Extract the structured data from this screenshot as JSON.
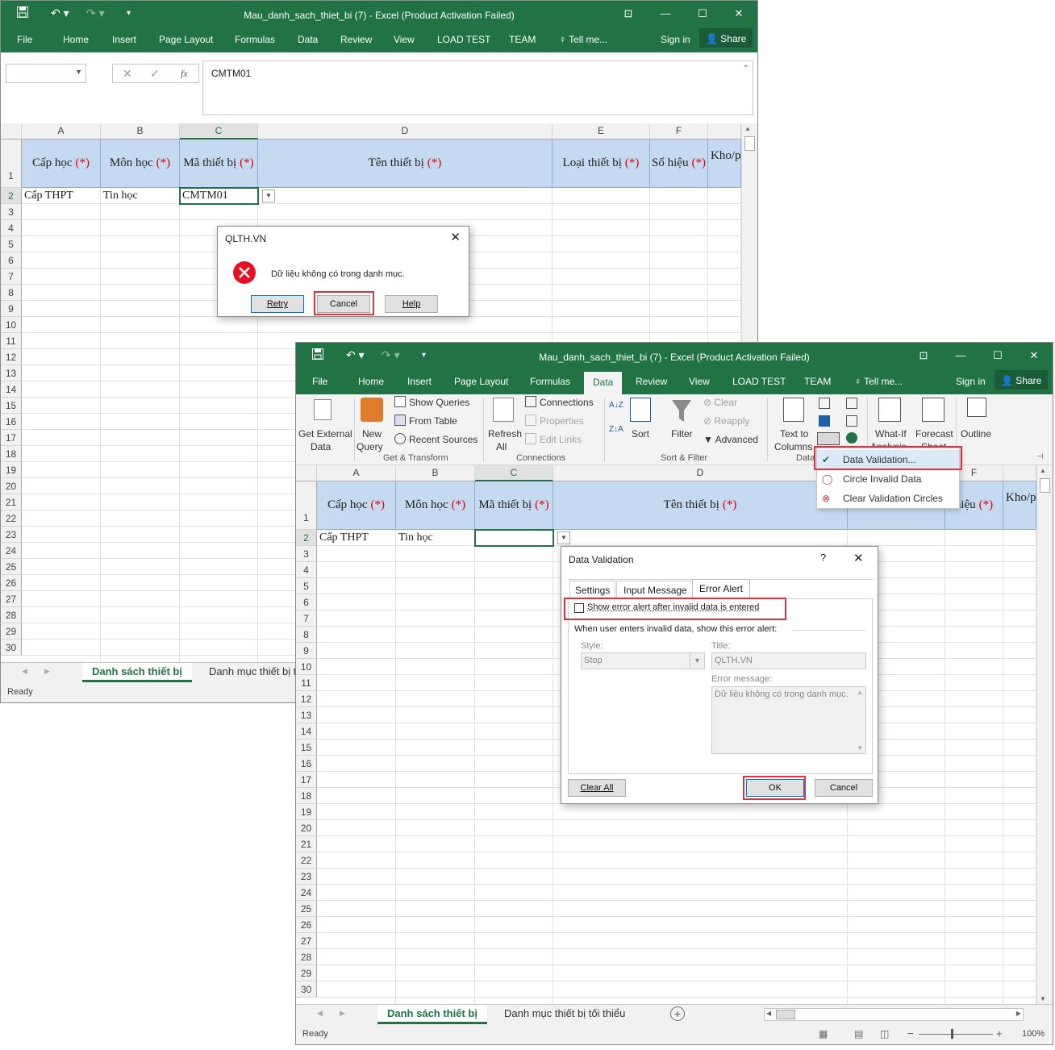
{
  "back": {
    "title": "Mau_danh_sach_thiet_bi (7) - Excel (Product Activation Failed)",
    "menu": [
      "File",
      "Home",
      "Insert",
      "Page Layout",
      "Formulas",
      "Data",
      "Review",
      "View",
      "LOAD TEST",
      "TEAM"
    ],
    "tellme": "Tell me...",
    "signin": "Sign in",
    "share": "Share",
    "formula": "CMTM01",
    "fx": "fx",
    "columns": [
      "A",
      "B",
      "C",
      "D",
      "E",
      "F"
    ],
    "rows": [
      "1",
      "2",
      "3",
      "4",
      "5",
      "6",
      "7",
      "8",
      "9",
      "10",
      "11",
      "12",
      "13",
      "14",
      "15",
      "16",
      "17",
      "18",
      "19",
      "20",
      "21",
      "22",
      "23",
      "24",
      "25",
      "26",
      "27",
      "28",
      "29",
      "30"
    ],
    "headers": [
      "Cấp học",
      "Môn học",
      "Mã thiết bị",
      "Tên thiết bị",
      "Loại thiết bị",
      "Số hiệu",
      "Kho/p"
    ],
    "req": "(*)",
    "row2": [
      "Cấp THPT",
      "Tin học",
      "CMTM01"
    ],
    "tabs": [
      "Danh sách thiết bị",
      "Danh mục thiết bị t"
    ],
    "status": "Ready"
  },
  "alert": {
    "title": "QLTH.VN",
    "message": "Dữ liệu không có trong danh mục.",
    "retry": "Retry",
    "cancel": "Cancel",
    "help": "Help"
  },
  "front": {
    "title": "Mau_danh_sach_thiet_bi (7) - Excel (Product Activation Failed)",
    "menu": [
      "File",
      "Home",
      "Insert",
      "Page Layout",
      "Formulas",
      "Data",
      "Review",
      "View",
      "LOAD TEST",
      "TEAM"
    ],
    "tellme": "Tell me...",
    "signin": "Sign in",
    "share": "Share",
    "ribbon": {
      "get_external": [
        "Get External",
        "Data"
      ],
      "new_query": [
        "New",
        "Query"
      ],
      "show_queries": "Show Queries",
      "from_table": "From Table",
      "recent_sources": "Recent Sources",
      "refresh_all": [
        "Refresh",
        "All"
      ],
      "connections": "Connections",
      "properties": "Properties",
      "edit_links": "Edit Links",
      "sort": "Sort",
      "filter": "Filter",
      "clear": "Clear",
      "reapply": "Reapply",
      "advanced": "Advanced",
      "text_to_columns": [
        "Text to",
        "Columns"
      ],
      "what_if": [
        "What-If",
        "Analysis"
      ],
      "forecast": [
        "Forecast",
        "Sheet"
      ],
      "outline": "Outline",
      "groups": [
        "Get & Transform",
        "Connections",
        "Sort & Filter",
        "Data"
      ]
    },
    "dv_menu": [
      "Data Validation...",
      "Circle Invalid Data",
      "Clear Validation Circles"
    ],
    "columns": [
      "A",
      "B",
      "C",
      "D",
      "F"
    ],
    "rows": [
      "1",
      "2",
      "3",
      "4",
      "5",
      "6",
      "7",
      "8",
      "9",
      "10",
      "11",
      "12",
      "13",
      "14",
      "15",
      "16",
      "17",
      "18",
      "19",
      "20",
      "21",
      "22",
      "23",
      "24",
      "25",
      "26",
      "27",
      "28",
      "29",
      "30"
    ],
    "headers": [
      "Cấp học",
      "Môn học",
      "Mã thiết bị",
      "Tên thiết bị",
      "hiệu",
      "Kho/p"
    ],
    "row2": [
      "Cấp THPT",
      "Tin học"
    ],
    "tabs": [
      "Danh sách thiết bị",
      "Danh mục thiết bị tối thiểu"
    ],
    "status": "Ready",
    "zoom": "100%"
  },
  "dv": {
    "title": "Data Validation",
    "help": "?",
    "tabs": [
      "Settings",
      "Input Message",
      "Error Alert"
    ],
    "checkbox_label": "Show error alert after invalid data is entered",
    "checked": false,
    "section": "When user enters invalid data, show this error alert:",
    "style_label": "Style:",
    "style_value": "Stop",
    "title_label": "Title:",
    "title_value": "QLTH.VN",
    "msg_label": "Error message:",
    "msg_value": "Dữ liệu không có trong danh mục.",
    "clear_all": "Clear All",
    "ok": "OK",
    "cancel": "Cancel"
  },
  "colors": {
    "excel_green": "#217346",
    "header_fill": "#c5d9f1",
    "highlight": "#e2303d"
  }
}
